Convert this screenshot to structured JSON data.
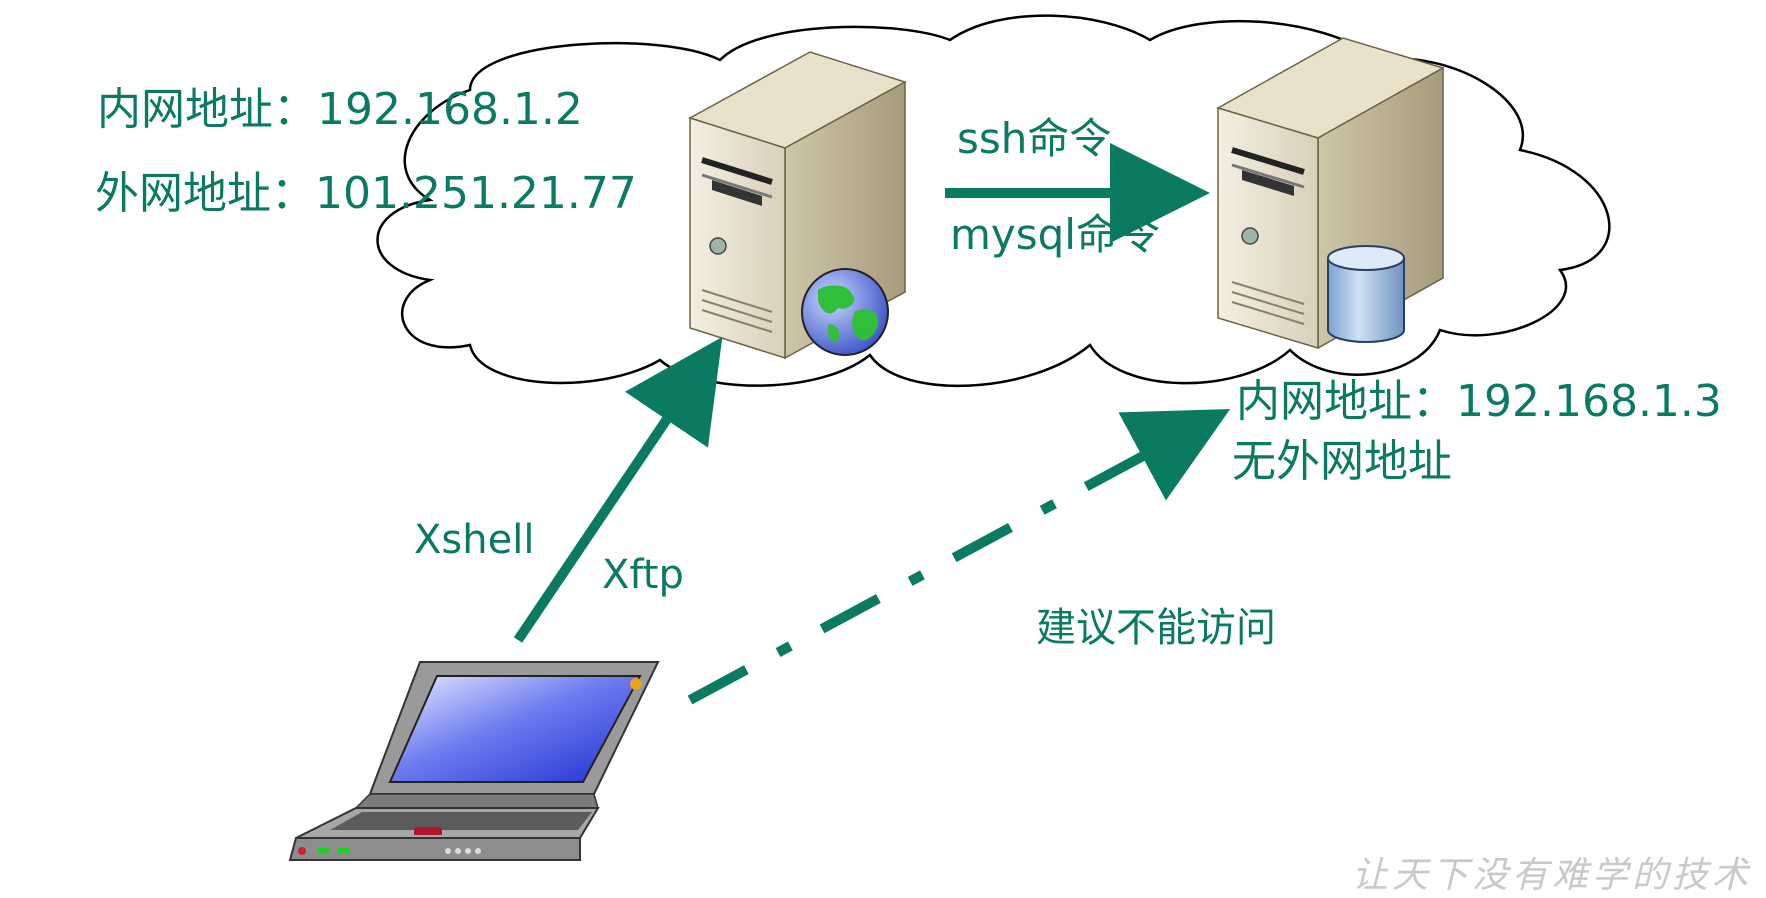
{
  "left_server": {
    "internal_address": "内网地址：192.168.1.2",
    "external_address": "外网地址：101.251.21.77",
    "icon": "web-server-globe-icon"
  },
  "right_server": {
    "internal_address": "内网地址：192.168.1.3",
    "external_note": "无外网地址",
    "icon": "database-server-icon"
  },
  "server_link": {
    "label_top": "ssh命令",
    "label_bottom": "mysql命令"
  },
  "laptop_link": {
    "label_left": "Xshell",
    "label_right": "Xftp"
  },
  "blocked_link": {
    "label": "建议不能访问"
  },
  "watermark": "让天下没有难学的技术",
  "colors": {
    "accent": "#0b7a63",
    "cloud_stroke": "#000000",
    "watermark": "#c9c9c9"
  }
}
